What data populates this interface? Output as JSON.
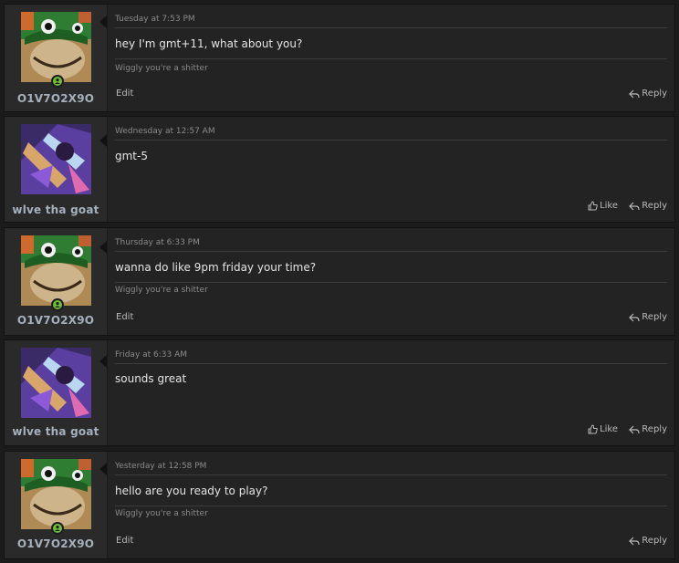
{
  "posts": [
    {
      "author": "O1V7O2X9O",
      "avatar": "green-hat-character-avatar",
      "online": true,
      "date": "Tuesday at 7:53 PM",
      "message": "hey I'm gmt+11, what about you?",
      "signature": "Wiggly you're a shitter",
      "edit_label": "Edit",
      "like_label": null,
      "reply_label": "Reply"
    },
    {
      "author": "wlve tha goat",
      "avatar": "purple-splash-art-avatar",
      "online": false,
      "date": "Wednesday at 12:57 AM",
      "message": "gmt-5",
      "signature": null,
      "edit_label": null,
      "like_label": "Like",
      "reply_label": "Reply"
    },
    {
      "author": "O1V7O2X9O",
      "avatar": "green-hat-character-avatar",
      "online": true,
      "date": "Thursday at 6:33 PM",
      "message": "wanna do like 9pm friday your time?",
      "signature": "Wiggly you're a shitter",
      "edit_label": "Edit",
      "like_label": null,
      "reply_label": "Reply"
    },
    {
      "author": "wlve tha goat",
      "avatar": "purple-splash-art-avatar",
      "online": false,
      "date": "Friday at 6:33 AM",
      "message": "sounds great",
      "signature": null,
      "edit_label": null,
      "like_label": "Like",
      "reply_label": "Reply"
    },
    {
      "author": "O1V7O2X9O",
      "avatar": "green-hat-character-avatar",
      "online": true,
      "date": "Yesterday at 12:58 PM",
      "message": "hello are you ready to play?",
      "signature": "Wiggly you're a shitter",
      "edit_label": "Edit",
      "like_label": null,
      "reply_label": "Reply"
    }
  ],
  "colors": {
    "background": "#1b1b1b",
    "post_bg": "#232323",
    "user_col_bg": "#2a2a2a",
    "username": "#a6b0bd",
    "online": "#6fbf3a"
  }
}
